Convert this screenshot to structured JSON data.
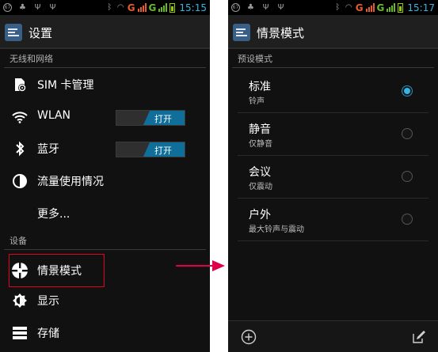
{
  "status_bar": {
    "time": "15:15",
    "time_right": "15:17",
    "network_letter": "G",
    "notification_icons": [
      "notification-circle-icon",
      "android-icon",
      "usb-icon",
      "usb-icon"
    ],
    "colors": {
      "network": "#e85a2a",
      "network2": "#66bb22",
      "clock": "#33b5e5",
      "battery": "#99cc00"
    }
  },
  "settings": {
    "title": "设置",
    "sections": [
      {
        "header": "无线和网络"
      },
      {
        "header": "设备"
      }
    ],
    "items": [
      {
        "label": "SIM 卡管理",
        "icon": "sim-card-icon"
      },
      {
        "label": "WLAN",
        "icon": "wifi-icon",
        "toggle": "打开"
      },
      {
        "label": "蓝牙",
        "icon": "bluetooth-icon",
        "toggle": "打开"
      },
      {
        "label": "流量使用情况",
        "icon": "data-usage-icon"
      },
      {
        "label": "更多..."
      },
      {
        "label": "情景模式",
        "icon": "audio-profile-icon",
        "highlighted": true
      },
      {
        "label": "显示",
        "icon": "brightness-icon"
      },
      {
        "label": "存储",
        "icon": "storage-icon"
      }
    ]
  },
  "profiles": {
    "title": "情景模式",
    "section_header": "预设模式",
    "modes": [
      {
        "title": "标准",
        "subtitle": "铃声",
        "selected": true
      },
      {
        "title": "静音",
        "subtitle": "仅静音",
        "selected": false
      },
      {
        "title": "会议",
        "subtitle": "仅震动",
        "selected": false
      },
      {
        "title": "户外",
        "subtitle": "最大铃声与震动",
        "selected": false
      }
    ],
    "bottom_actions": [
      "add-icon",
      "edit-icon"
    ]
  },
  "annotation": {
    "arrow_color": "#e0004a",
    "highlight_color": "#e0001f"
  }
}
